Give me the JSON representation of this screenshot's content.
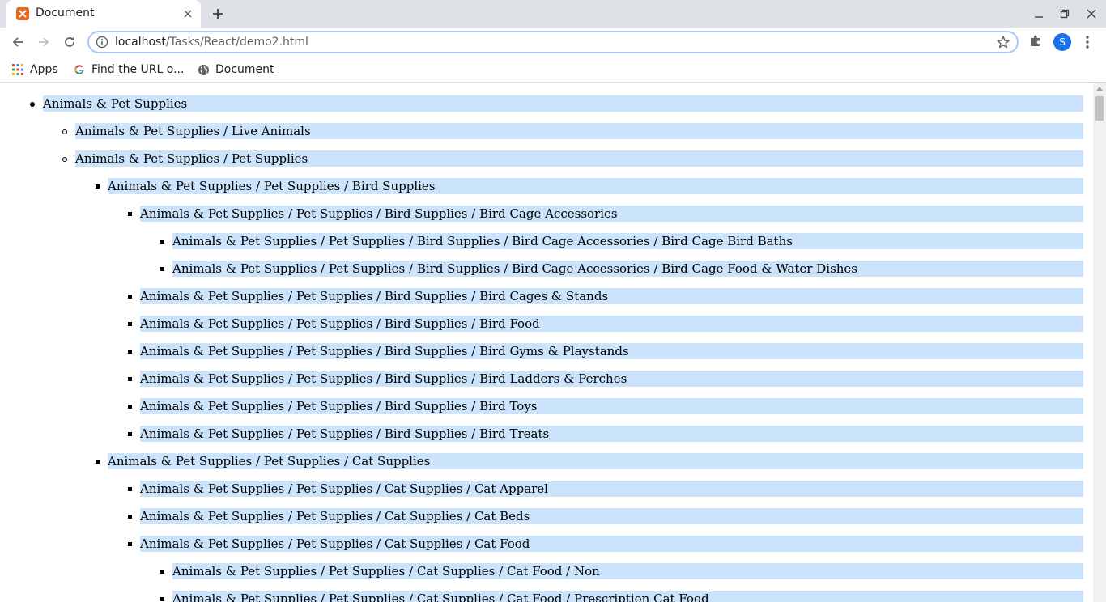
{
  "browser": {
    "tab_title": "Document",
    "url_host": "localhost",
    "url_path": "/Tasks/React/demo2.html",
    "profile_initial": "S",
    "accent_color": "#1a73e8",
    "bookmarks": [
      {
        "label": "Apps",
        "icon": "apps-grid-icon"
      },
      {
        "label": "Find the URL o...",
        "icon": "google-icon"
      },
      {
        "label": "Document",
        "icon": "globe-icon"
      }
    ]
  },
  "page": {
    "highlight_color": "#cce4fb",
    "tree": [
      {
        "level": 0,
        "label": "Animals & Pet Supplies"
      },
      {
        "level": 1,
        "label": "Animals & Pet Supplies / Live Animals"
      },
      {
        "level": 1,
        "label": "Animals & Pet Supplies / Pet Supplies"
      },
      {
        "level": 2,
        "label": "Animals & Pet Supplies / Pet Supplies / Bird Supplies"
      },
      {
        "level": 3,
        "label": "Animals & Pet Supplies / Pet Supplies / Bird Supplies / Bird Cage Accessories"
      },
      {
        "level": 4,
        "label": "Animals & Pet Supplies / Pet Supplies / Bird Supplies / Bird Cage Accessories / Bird Cage Bird Baths"
      },
      {
        "level": 4,
        "label": "Animals & Pet Supplies / Pet Supplies / Bird Supplies / Bird Cage Accessories / Bird Cage Food & Water Dishes"
      },
      {
        "level": 3,
        "label": "Animals & Pet Supplies / Pet Supplies / Bird Supplies / Bird Cages & Stands"
      },
      {
        "level": 3,
        "label": "Animals & Pet Supplies / Pet Supplies / Bird Supplies / Bird Food"
      },
      {
        "level": 3,
        "label": "Animals & Pet Supplies / Pet Supplies / Bird Supplies / Bird Gyms & Playstands"
      },
      {
        "level": 3,
        "label": "Animals & Pet Supplies / Pet Supplies / Bird Supplies / Bird Ladders & Perches"
      },
      {
        "level": 3,
        "label": "Animals & Pet Supplies / Pet Supplies / Bird Supplies / Bird Toys"
      },
      {
        "level": 3,
        "label": "Animals & Pet Supplies / Pet Supplies / Bird Supplies / Bird Treats"
      },
      {
        "level": 2,
        "label": "Animals & Pet Supplies / Pet Supplies / Cat Supplies"
      },
      {
        "level": 3,
        "label": "Animals & Pet Supplies / Pet Supplies / Cat Supplies / Cat Apparel"
      },
      {
        "level": 3,
        "label": "Animals & Pet Supplies / Pet Supplies / Cat Supplies / Cat Beds"
      },
      {
        "level": 3,
        "label": "Animals & Pet Supplies / Pet Supplies / Cat Supplies / Cat Food"
      },
      {
        "level": 4,
        "label": "Animals & Pet Supplies / Pet Supplies / Cat Supplies / Cat Food / Non"
      },
      {
        "level": 4,
        "label": "Animals & Pet Supplies / Pet Supplies / Cat Supplies / Cat Food / Prescription Cat Food"
      }
    ]
  }
}
